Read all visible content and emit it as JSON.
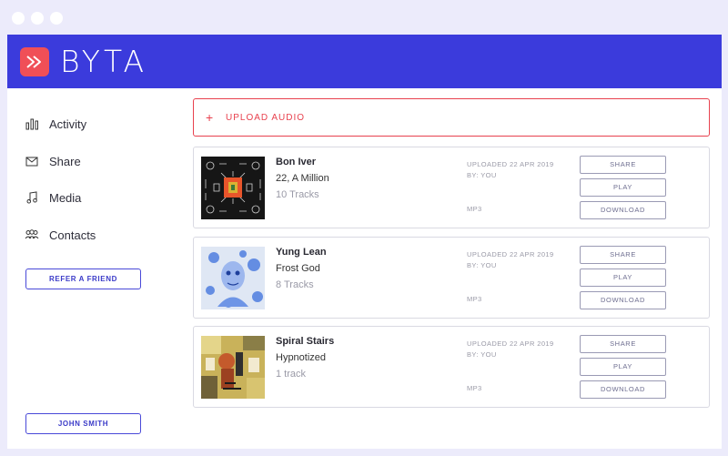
{
  "window": {
    "dots": [
      "dot",
      "dot",
      "dot"
    ]
  },
  "app": {
    "brand": "BYTA",
    "accent": "#3b3bdc",
    "brand_red": "#f04f57",
    "logo_icon": "fast-forward-icon"
  },
  "sidebar": {
    "items": [
      {
        "label": "Activity",
        "icon": "bar-chart-icon"
      },
      {
        "label": "Share",
        "icon": "envelope-icon"
      },
      {
        "label": "Media",
        "icon": "music-note-icon"
      },
      {
        "label": "Contacts",
        "icon": "people-icon"
      }
    ],
    "refer_label": "REFER A FRIEND",
    "user_label": "JOHN SMITH"
  },
  "upload": {
    "plus": "+",
    "label": "UPLOAD AUDIO"
  },
  "cards": [
    {
      "artist": "Bon Iver",
      "album": "22, A Million",
      "tracks": "10 Tracks",
      "uploaded": "UPLOADED 22 APR 2019",
      "by": "BY: YOU",
      "format": "MP3",
      "share": "SHARE",
      "play": "PLAY",
      "download": "DOWNLOAD"
    },
    {
      "artist": "Yung Lean",
      "album": "Frost God",
      "tracks": "8 Tracks",
      "uploaded": "UPLOADED 22 APR 2019",
      "by": "BY: YOU",
      "format": "MP3",
      "share": "SHARE",
      "play": "PLAY",
      "download": "DOWNLOAD"
    },
    {
      "artist": "Spiral Stairs",
      "album": "Hypnotized",
      "tracks": "1 track",
      "uploaded": "UPLOADED 22 APR 2019",
      "by": "BY: YOU",
      "format": "MP3",
      "share": "SHARE",
      "play": "PLAY",
      "download": "DOWNLOAD"
    }
  ]
}
